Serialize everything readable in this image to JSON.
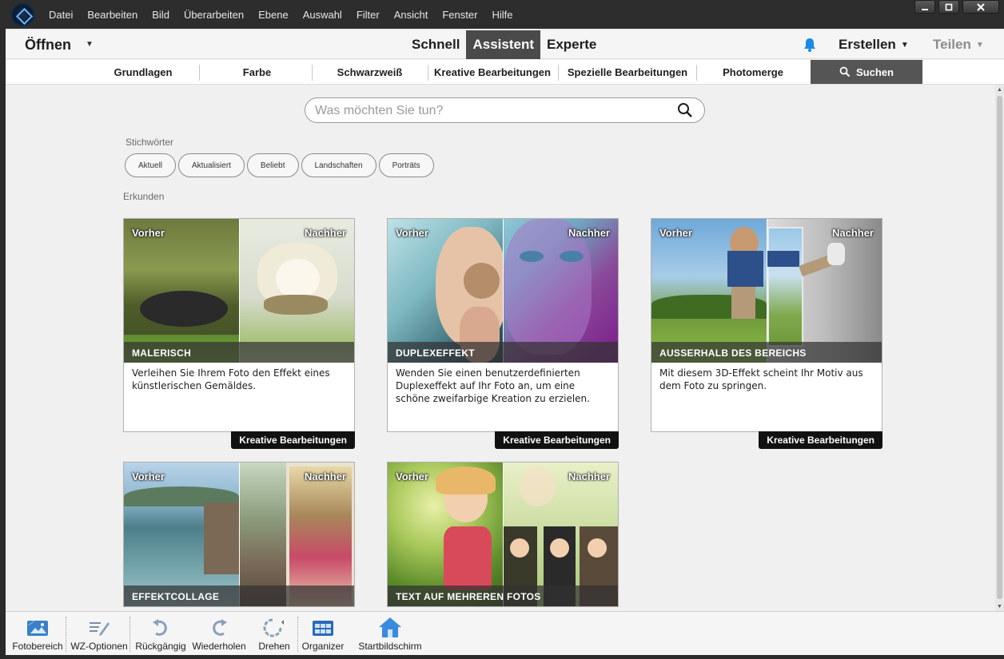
{
  "menubar": {
    "items": [
      "Datei",
      "Bearbeiten",
      "Bild",
      "Überarbeiten",
      "Ebene",
      "Auswahl",
      "Filter",
      "Ansicht",
      "Fenster",
      "Hilfe"
    ],
    "window_buttons": [
      "_",
      "▫",
      "✕"
    ]
  },
  "modebar": {
    "open_label": "Öffnen",
    "modes": [
      "Schnell",
      "Assistent",
      "Experte"
    ],
    "active_mode": "Assistent",
    "create_label": "Erstellen",
    "share_label": "Teilen"
  },
  "tabs": {
    "items": [
      "Grundlagen",
      "Farbe",
      "Schwarzweiß",
      "Kreative Bearbeitungen",
      "Spezielle Bearbeitungen",
      "Photomerge"
    ],
    "search_label": "Suchen"
  },
  "search": {
    "placeholder": "Was möchten Sie tun?"
  },
  "keywords": {
    "label": "Stichwörter",
    "chips": [
      "Aktuell",
      "Aktualisiert",
      "Beliebt",
      "Landschaften",
      "Porträts"
    ]
  },
  "explore": {
    "label": "Erkunden"
  },
  "cards": [
    {
      "before": "Vorher",
      "after": "Nachher",
      "title": "MALERISCH",
      "description": "Verleihen Sie Ihrem Foto den Effekt eines künstlerischen Gemäldes.",
      "category": "Kreative Bearbeitungen"
    },
    {
      "before": "Vorher",
      "after": "Nachher",
      "title": "DUPLEXEFFEKT",
      "description": "Wenden Sie einen benutzerdefinierten Duplexeffekt auf Ihr Foto an, um eine schöne zweifarbige Kreation zu erzielen.",
      "category": "Kreative Bearbeitungen"
    },
    {
      "before": "Vorher",
      "after": "Nachher",
      "title": "AUSSERHALB DES BEREICHS",
      "description": "Mit diesem 3D-Effekt scheint Ihr Motiv aus dem Foto zu springen.",
      "category": "Kreative Bearbeitungen"
    },
    {
      "before": "Vorher",
      "after": "Nachher",
      "title": "EFFEKTCOLLAGE",
      "description": "",
      "category": ""
    },
    {
      "before": "Vorher",
      "after": "Nachher",
      "title": "TEXT AUF MEHREREN FOTOS",
      "description": "",
      "category": ""
    }
  ],
  "toolbar": {
    "photo_bin": "Fotobereich",
    "tool_options": "WZ-Optionen",
    "undo": "Rückgängig",
    "redo": "Wiederholen",
    "rotate": "Drehen",
    "organizer": "Organizer",
    "home_screen": "Startbildschirm"
  }
}
